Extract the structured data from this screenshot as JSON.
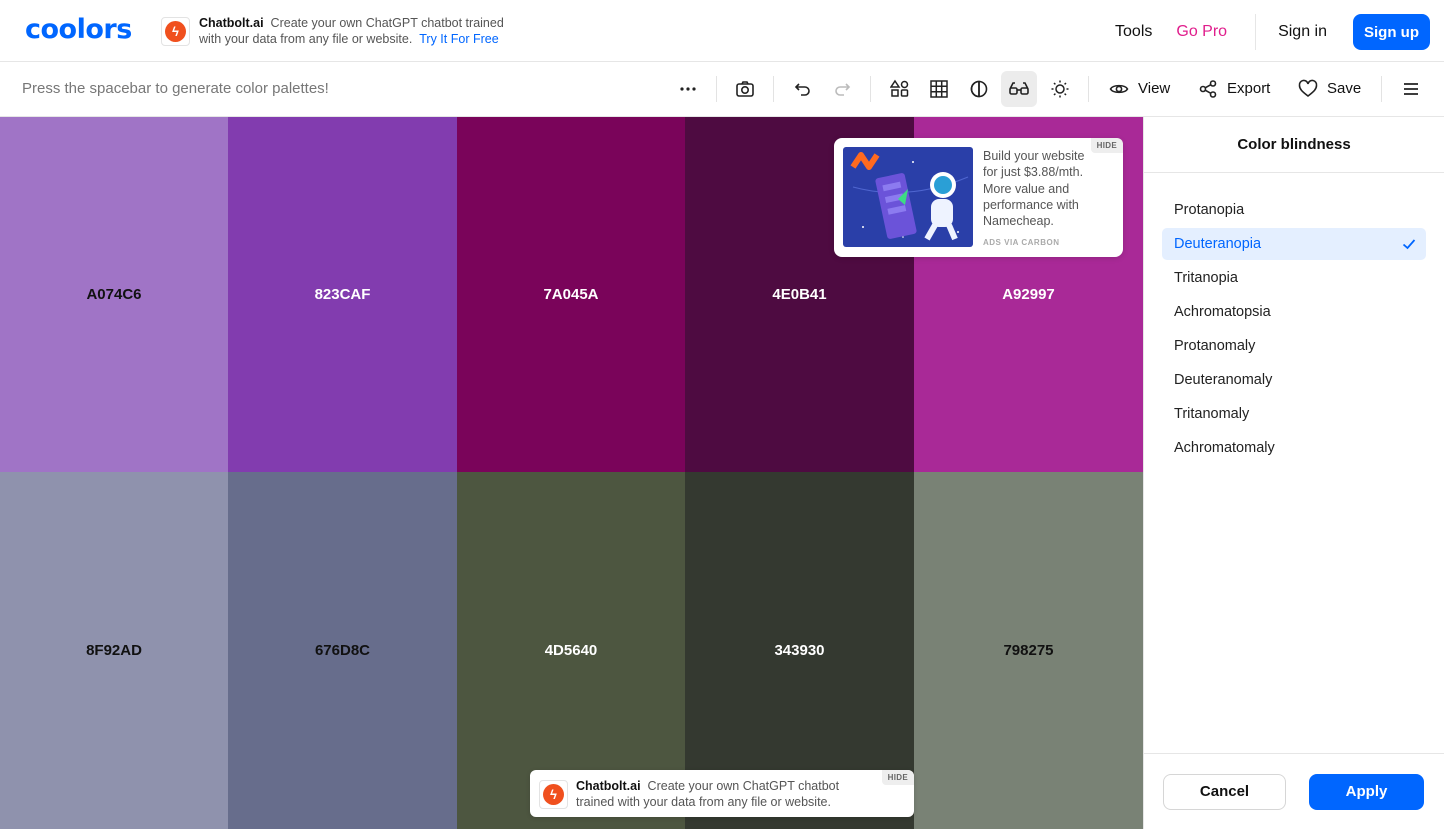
{
  "app": {
    "logo": "coolors",
    "accent": "#0066ff"
  },
  "header": {
    "ad": {
      "icon": "chatbolt-logo-icon",
      "brand": "Chatbolt.ai",
      "line1": "Create your own ChatGPT chatbot trained",
      "line2": "with your data from any file or website.",
      "cta": "Try It For Free"
    },
    "nav": {
      "tools": "Tools",
      "go_pro": "Go Pro",
      "sign_in": "Sign in",
      "sign_up": "Sign up"
    }
  },
  "toolbar": {
    "hint": "Press the spacebar to generate color palettes!",
    "icons": [
      "more-icon",
      "camera-icon",
      "undo-icon",
      "redo-icon",
      "shapes-icon",
      "grid-icon",
      "contrast-icon",
      "glasses-icon",
      "sun-icon"
    ],
    "view_label": "View",
    "export_label": "Export",
    "save_label": "Save"
  },
  "palette": {
    "top_row": [
      {
        "hex": "A074C6",
        "color": "#A074C6",
        "text_color": "#111111"
      },
      {
        "hex": "823CAF",
        "color": "#823CAF",
        "text_color": "#ffffff"
      },
      {
        "hex": "7A045A",
        "color": "#7A045A",
        "text_color": "#ffffff"
      },
      {
        "hex": "4E0B41",
        "color": "#4E0B41",
        "text_color": "#ffffff"
      },
      {
        "hex": "A92997",
        "color": "#A92997",
        "text_color": "#ffffff"
      }
    ],
    "bottom_row": [
      {
        "hex": "8F92AD",
        "color": "#8F92AD",
        "text_color": "#111111"
      },
      {
        "hex": "676D8C",
        "color": "#676D8C",
        "text_color": "#111111"
      },
      {
        "hex": "4D5640",
        "color": "#4D5640",
        "text_color": "#ffffff"
      },
      {
        "hex": "343930",
        "color": "#343930",
        "text_color": "#ffffff"
      },
      {
        "hex": "798275",
        "color": "#798275",
        "text_color": "#111111"
      }
    ]
  },
  "carbon_ad": {
    "copy": "Build your website for just $3.88/mth. More value and performance with Namecheap.",
    "via": "ADS VIA CARBON",
    "hide": "HIDE"
  },
  "bottom_ad": {
    "brand": "Chatbolt.ai",
    "line1": "Create your own ChatGPT chatbot",
    "line2": "trained with your data from any file or website.",
    "hide": "HIDE"
  },
  "color_blindness": {
    "title": "Color blindness",
    "options": [
      "Protanopia",
      "Deuteranopia",
      "Tritanopia",
      "Achromatopsia",
      "Protanomaly",
      "Deuteranomaly",
      "Tritanomaly",
      "Achromatomaly"
    ],
    "selected": "Deuteranopia",
    "cancel": "Cancel",
    "apply": "Apply"
  }
}
